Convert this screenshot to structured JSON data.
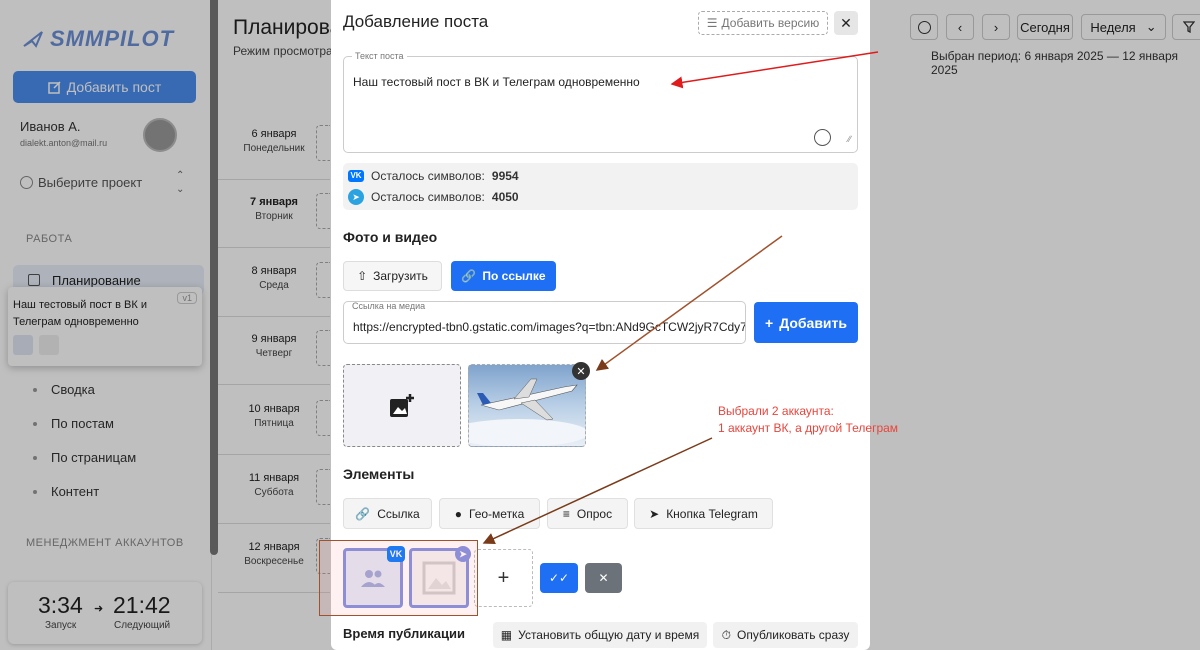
{
  "app": {
    "logo_text": "SMMPILOT"
  },
  "sidebar": {
    "add_post_label": "Добавить пост",
    "user_name": "Иванов А.",
    "user_email": "dialekt.anton@mail.ru",
    "project_placeholder": "Выберите проект",
    "section_work": "РАБОТА",
    "nav_planning": "Планирование",
    "analytics_items": [
      "Сводка",
      "По постам",
      "По страницам",
      "Контент"
    ],
    "section_accounts": "МЕНЕДЖМЕНТ АККАУНТОВ"
  },
  "preview_card": {
    "text": "Наш тестовый пост в ВК и Телеграм одновременно",
    "version_badge": "v1"
  },
  "timer": {
    "start_time": "3:34",
    "start_label": "Запуск",
    "next_time": "21:42",
    "next_label": "Следующий"
  },
  "main": {
    "title": "Планирова",
    "subtitle": "Режим просмотра",
    "days": [
      {
        "date": "6 января",
        "weekday": "Понедельник"
      },
      {
        "date": "7 января",
        "weekday": "Вторник"
      },
      {
        "date": "8 января",
        "weekday": "Среда"
      },
      {
        "date": "9 января",
        "weekday": "Четверг"
      },
      {
        "date": "10 января",
        "weekday": "Пятница"
      },
      {
        "date": "11 января",
        "weekday": "Суббота"
      },
      {
        "date": "12 января",
        "weekday": "Воскресенье"
      }
    ],
    "toolbar": {
      "today_label": "Сегодня",
      "view_label": "Неделя"
    },
    "period_text": "Выбран период: 6 января 2025 — 12 января 2025"
  },
  "modal": {
    "title": "Добавление поста",
    "add_version_label": "Добавить версию",
    "text_label": "Текст поста",
    "text_value": "Наш тестовый пост в ВК и Телеграм одновременно",
    "counters": [
      {
        "network": "vk",
        "label": "Осталось символов:",
        "value": "9954"
      },
      {
        "network": "telegram",
        "label": "Осталось символов:",
        "value": "4050"
      }
    ],
    "media_heading": "Фото и видео",
    "upload_label": "Загрузить",
    "by_link_label": "По ссылке",
    "url_label": "Ссылка на медиа",
    "url_value": "https://encrypted-tbn0.gstatic.com/images?q=tbn:ANd9GcTCW2jyR7Cdy7",
    "add_label": "Добавить",
    "elements_heading": "Элементы",
    "elements": [
      "Ссылка",
      "Гео-метка",
      "Опрос",
      "Кнопка Telegram"
    ],
    "publish_heading": "Время публикации",
    "set_date_label": "Установить общую дату и время",
    "publish_now_label": "Опубликовать сразу"
  },
  "annotation": {
    "line1": "Выбрали 2 аккаунта:",
    "line2": "1 аккаунт ВК, а другой Телеграм"
  },
  "colors": {
    "primary": "#1e6ff3",
    "annotation_red": "#e8453c",
    "accent_purple": "#7e8fe0"
  }
}
